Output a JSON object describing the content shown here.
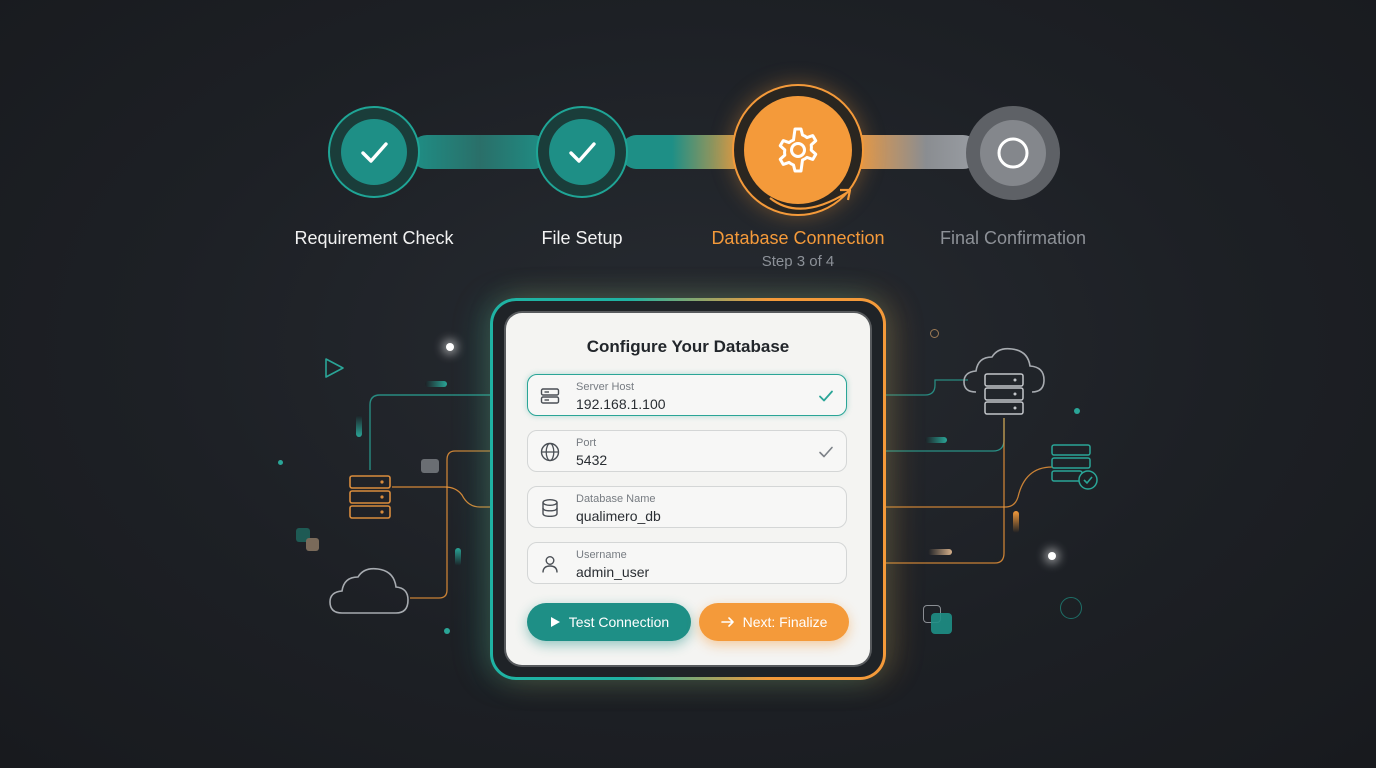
{
  "stepper": {
    "steps": [
      {
        "label": "Requirement Check",
        "state": "complete",
        "icon": "check-icon"
      },
      {
        "label": "File Setup",
        "state": "complete",
        "icon": "check-icon"
      },
      {
        "label": "Database Connection",
        "state": "current",
        "icon": "gear-icon",
        "sub": "Step 3 of 4"
      },
      {
        "label": "Final Confirmation",
        "state": "pending",
        "icon": "circle-icon"
      }
    ]
  },
  "form": {
    "title": "Configure Your Database",
    "fields": [
      {
        "label": "Server Host",
        "value": "192.168.1.100",
        "icon": "server-icon",
        "valid": true
      },
      {
        "label": "Port",
        "value": "5432",
        "icon": "globe-icon",
        "valid": true
      },
      {
        "label": "Database Name",
        "value": "qualimero_db",
        "icon": "database-icon",
        "valid": false
      },
      {
        "label": "Username",
        "value": "admin_user",
        "icon": "user-icon",
        "valid": false
      }
    ],
    "test_button": "Test Connection",
    "next_button": "Next: Finalize"
  },
  "colors": {
    "teal": "#1e8f86",
    "orange": "#f49a3a",
    "pending": "#9a9ea4",
    "background": "#1f2227"
  }
}
